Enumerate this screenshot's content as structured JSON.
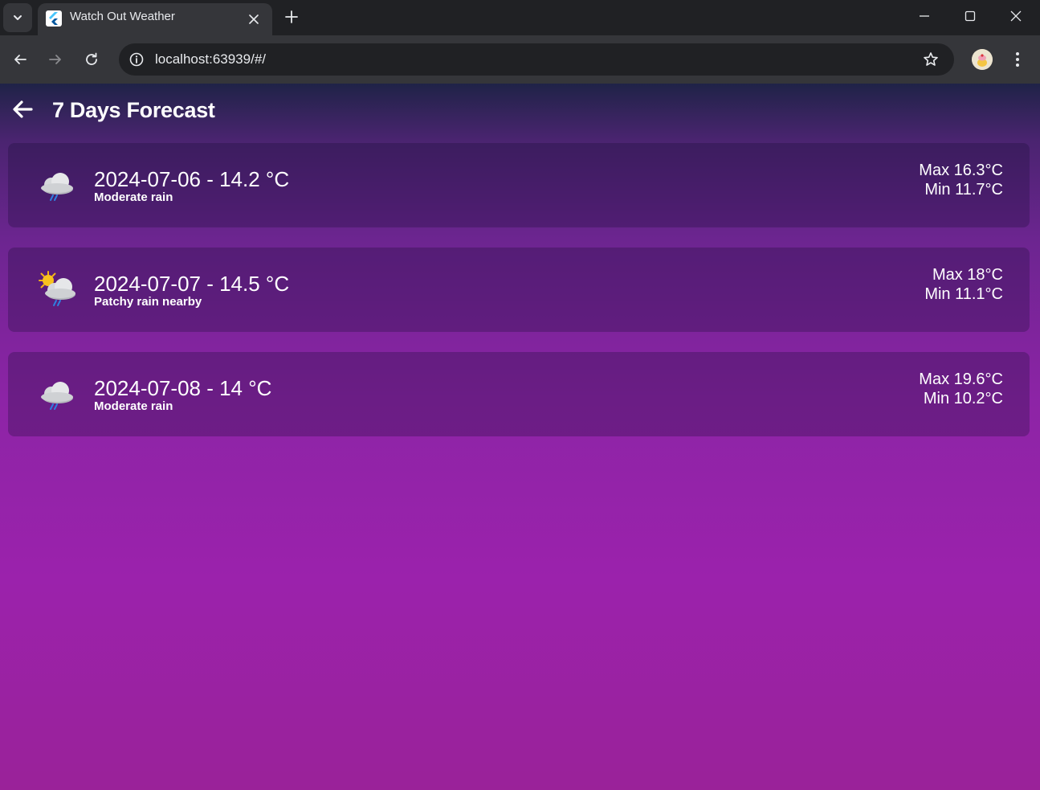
{
  "browser": {
    "tab_title": "Watch Out Weather",
    "url": "localhost:63939/#/"
  },
  "page": {
    "title": "7 Days Forecast"
  },
  "forecast": [
    {
      "date_temp": "2024-07-06 - 14.2 °C",
      "condition": "Moderate rain",
      "max": "Max 16.3°C",
      "min": "Min 11.7°C",
      "icon": "rain-cloud-icon"
    },
    {
      "date_temp": "2024-07-07 - 14.5 °C",
      "condition": "Patchy rain nearby",
      "max": "Max 18°C",
      "min": "Min 11.1°C",
      "icon": "sun-rain-cloud-icon"
    },
    {
      "date_temp": "2024-07-08 - 14 °C",
      "condition": "Moderate rain",
      "max": "Max 19.6°C",
      "min": "Min 10.2°C",
      "icon": "rain-cloud-icon"
    }
  ],
  "colors": {
    "chrome_dark": "#202124",
    "chrome_toolbar": "#35363a",
    "gradient_top": "#1f2347",
    "gradient_bottom": "#9b22ac",
    "rain_blue": "#2f7fe0"
  }
}
